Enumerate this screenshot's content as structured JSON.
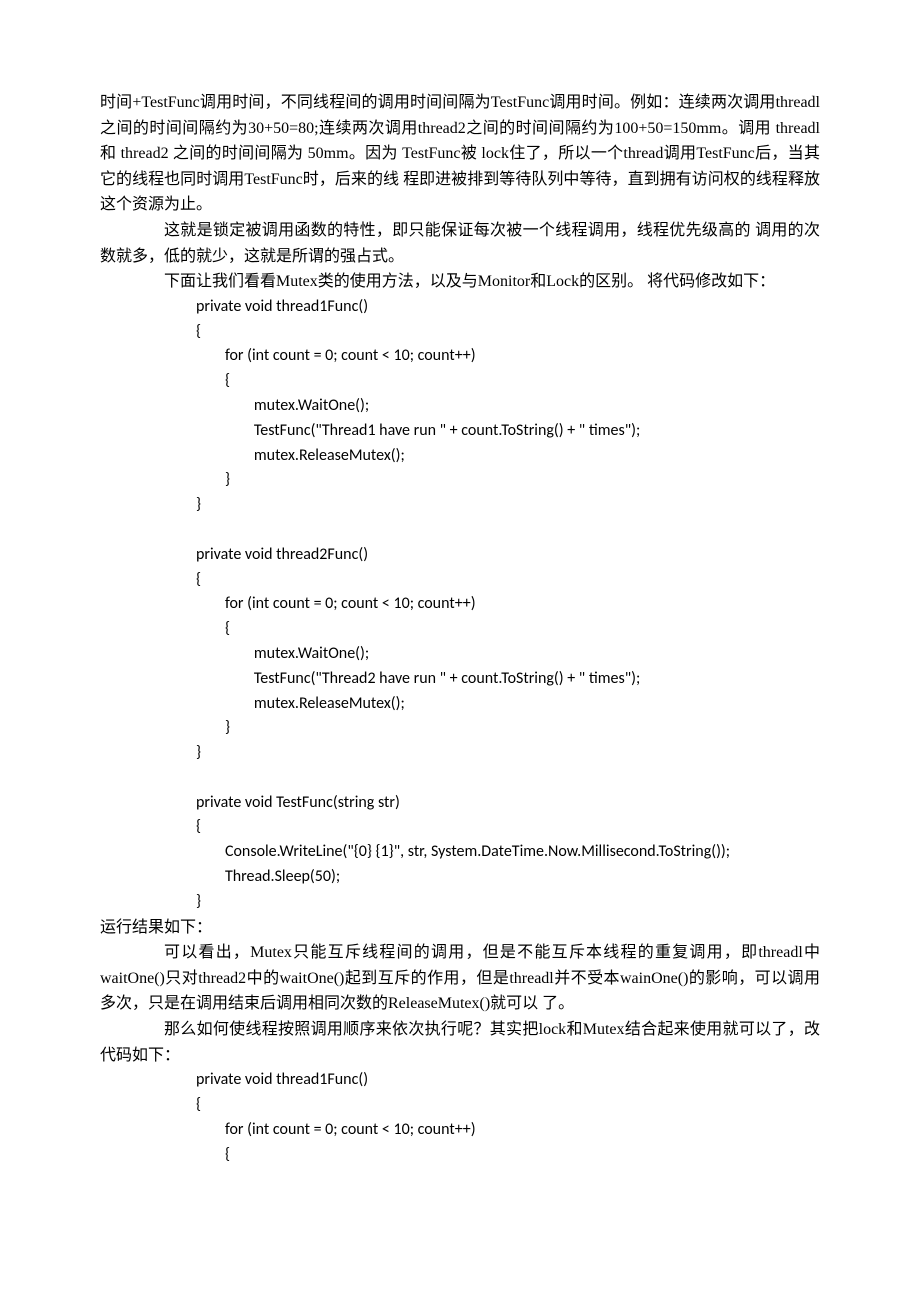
{
  "p1": "时间+TestFunc调用时间，不同线程间的调用时间间隔为TestFunc调用时间。例如：连续两次调用threadl之间的时间间隔约为30+50=80;连续两次调用thread2之间的时间间隔约为100+50=150mm。调用  threadl 和  thread2 之间的时间间隔为  50mm。因为  TestFunc被  lock住了，所以一个thread调用TestFunc后，当其它的线程也同时调用TestFunc时，后来的线  程即进被排到等待队列中等待，直到拥有访问权的线程释放这个资源为止。",
  "p2": "这就是锁定被调用函数的特性，即只能保证每次被一个线程调用，线程优先级高的  调用的次数就多，低的就少，这就是所谓的强占式。",
  "p3": "下面让我们看看Mutex类的使用方法，以及与Monitor和Lock的区别。  将代码修改如下：",
  "code1": "private void thread1Func()\n{\n        for (int count = 0; count < 10; count++)\n        {\n                mutex.WaitOne();\n                TestFunc(\"Thread1 have run \" + count.ToString() + \" times\");\n                mutex.ReleaseMutex();\n        }\n}\n\nprivate void thread2Func()\n{\n        for (int count = 0; count < 10; count++)\n        {\n                mutex.WaitOne();\n                TestFunc(\"Thread2 have run \" + count.ToString() + \" times\");\n                mutex.ReleaseMutex();\n        }\n}\n\nprivate void TestFunc(string str)\n{\n        Console.WriteLine(\"{0} {1}\", str, System.DateTime.Now.Millisecond.ToString());\n        Thread.Sleep(50);\n}",
  "p4": "运行结果如下：",
  "p5": "可以看出，Mutex只能互斥线程间的调用，但是不能互斥本线程的重复调用，即threadl中waitOne()只对thread2中的waitOne()起到互斥的作用，但是threadl并不受本wainOne()的影响，可以调用多次，只是在调用结束后调用相同次数的ReleaseMutex()就可以  了。",
  "p6": "那么如何使线程按照调用顺序来依次执行呢？其实把lock和Mutex结合起来使用就可以了，改代码如下：",
  "code2": "private void thread1Func()\n{\n        for (int count = 0; count < 10; count++)\n        {"
}
